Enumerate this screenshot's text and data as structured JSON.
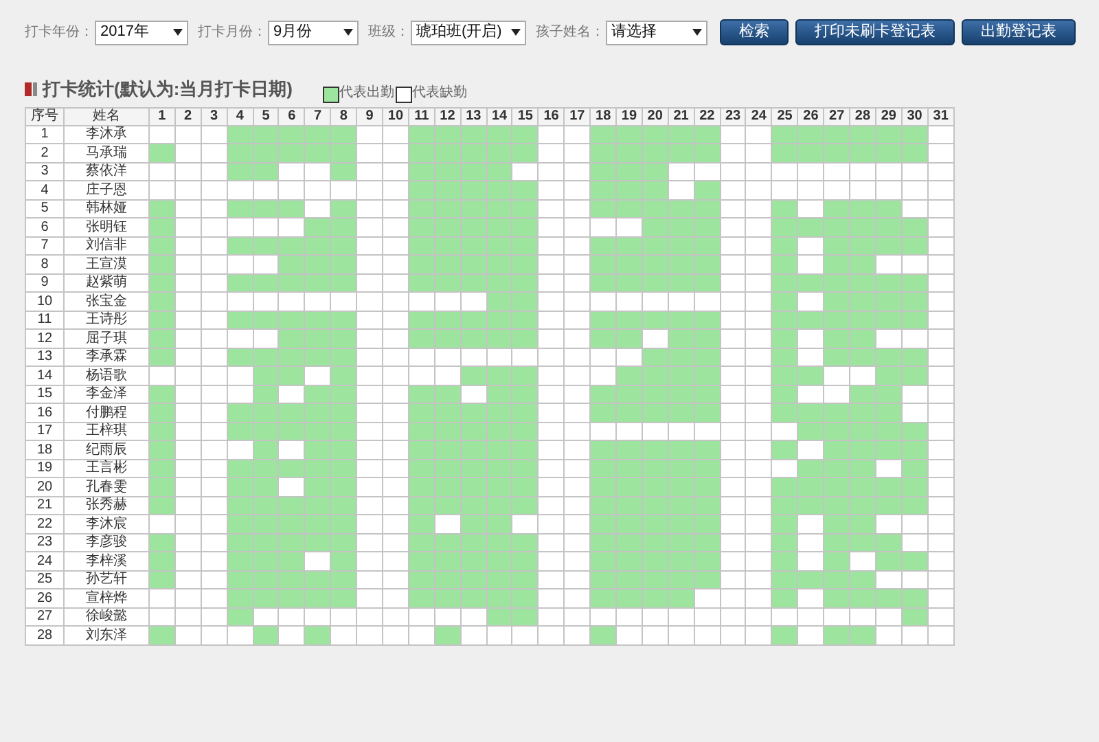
{
  "filters": [
    {
      "label": "打卡年份：",
      "value": "2017年"
    },
    {
      "label": "打卡月份：",
      "value": "9月份"
    },
    {
      "label": "班级：",
      "value": "琥珀班(开启)"
    },
    {
      "label": "孩子姓名：",
      "value": "请选择"
    }
  ],
  "buttons": [
    "检索",
    "打印未刷卡登记表",
    "出勤登记表"
  ],
  "section_title": "打卡统计(默认为:当月打卡日期)",
  "legend": [
    {
      "label": "代表出勤",
      "present": true
    },
    {
      "label": "代表缺勤",
      "present": false
    }
  ],
  "table": {
    "columns": [
      "序号",
      "姓名",
      "1",
      "2",
      "3",
      "4",
      "5",
      "6",
      "7",
      "8",
      "9",
      "10",
      "11",
      "12",
      "13",
      "14",
      "15",
      "16",
      "17",
      "18",
      "19",
      "20",
      "21",
      "22",
      "23",
      "24",
      "25",
      "26",
      "27",
      "28",
      "29",
      "30",
      "31"
    ],
    "rows": [
      {
        "no": "1",
        "name": "李沐承",
        "days": [
          false,
          false,
          false,
          true,
          true,
          true,
          true,
          true,
          false,
          false,
          true,
          true,
          true,
          true,
          true,
          false,
          false,
          true,
          true,
          true,
          true,
          true,
          false,
          false,
          true,
          true,
          true,
          true,
          true,
          true,
          false
        ]
      },
      {
        "no": "2",
        "name": "马承瑞",
        "days": [
          true,
          false,
          false,
          true,
          true,
          true,
          true,
          true,
          false,
          false,
          true,
          true,
          true,
          true,
          true,
          false,
          false,
          true,
          true,
          true,
          true,
          true,
          false,
          false,
          true,
          true,
          true,
          true,
          true,
          true,
          false
        ]
      },
      {
        "no": "3",
        "name": "蔡依洋",
        "days": [
          false,
          false,
          false,
          true,
          true,
          false,
          false,
          true,
          false,
          false,
          true,
          true,
          true,
          true,
          false,
          false,
          false,
          true,
          true,
          true,
          false,
          false,
          false,
          false,
          false,
          false,
          false,
          false,
          false,
          false,
          false
        ]
      },
      {
        "no": "4",
        "name": "庄子恩",
        "days": [
          false,
          false,
          false,
          false,
          false,
          false,
          false,
          false,
          false,
          false,
          true,
          true,
          true,
          true,
          true,
          false,
          false,
          true,
          true,
          true,
          false,
          true,
          false,
          false,
          false,
          false,
          false,
          false,
          false,
          false,
          false
        ]
      },
      {
        "no": "5",
        "name": "韩林娅",
        "days": [
          true,
          false,
          false,
          true,
          true,
          true,
          false,
          true,
          false,
          false,
          true,
          true,
          true,
          true,
          true,
          false,
          false,
          true,
          true,
          true,
          true,
          true,
          false,
          false,
          true,
          false,
          true,
          true,
          true,
          false,
          false
        ]
      },
      {
        "no": "6",
        "name": "张明钰",
        "days": [
          true,
          false,
          false,
          false,
          false,
          false,
          true,
          true,
          false,
          false,
          true,
          true,
          true,
          true,
          true,
          false,
          false,
          false,
          false,
          true,
          true,
          true,
          false,
          false,
          true,
          true,
          true,
          true,
          true,
          true,
          false
        ]
      },
      {
        "no": "7",
        "name": "刘信非",
        "days": [
          true,
          false,
          false,
          true,
          true,
          true,
          true,
          true,
          false,
          false,
          true,
          true,
          true,
          true,
          true,
          false,
          false,
          true,
          true,
          true,
          true,
          true,
          false,
          false,
          true,
          false,
          true,
          true,
          true,
          true,
          false
        ]
      },
      {
        "no": "8",
        "name": "王宣漠",
        "days": [
          true,
          false,
          false,
          false,
          false,
          true,
          true,
          true,
          false,
          false,
          true,
          true,
          true,
          true,
          true,
          false,
          false,
          true,
          true,
          true,
          true,
          true,
          false,
          false,
          true,
          false,
          true,
          true,
          false,
          false,
          false
        ]
      },
      {
        "no": "9",
        "name": "赵紫萌",
        "days": [
          true,
          false,
          false,
          true,
          true,
          true,
          true,
          true,
          false,
          false,
          true,
          true,
          true,
          true,
          true,
          false,
          false,
          true,
          true,
          true,
          true,
          true,
          false,
          false,
          true,
          true,
          true,
          true,
          true,
          true,
          false
        ]
      },
      {
        "no": "10",
        "name": "张宝金",
        "days": [
          true,
          false,
          false,
          false,
          false,
          false,
          false,
          false,
          false,
          false,
          false,
          false,
          false,
          true,
          true,
          false,
          false,
          false,
          false,
          false,
          false,
          false,
          false,
          false,
          true,
          false,
          true,
          true,
          true,
          true,
          false
        ]
      },
      {
        "no": "11",
        "name": "王诗彤",
        "days": [
          true,
          false,
          false,
          true,
          true,
          true,
          true,
          true,
          false,
          false,
          true,
          true,
          true,
          true,
          true,
          false,
          false,
          true,
          true,
          true,
          true,
          true,
          false,
          false,
          true,
          true,
          true,
          true,
          true,
          true,
          false
        ]
      },
      {
        "no": "12",
        "name": "屈子琪",
        "days": [
          true,
          false,
          false,
          false,
          false,
          true,
          true,
          true,
          false,
          false,
          true,
          true,
          true,
          true,
          true,
          false,
          false,
          true,
          true,
          false,
          true,
          true,
          false,
          false,
          true,
          false,
          true,
          true,
          false,
          false,
          false
        ]
      },
      {
        "no": "13",
        "name": "李承霖",
        "days": [
          true,
          false,
          false,
          true,
          true,
          true,
          true,
          true,
          false,
          false,
          false,
          false,
          false,
          false,
          false,
          false,
          false,
          false,
          false,
          true,
          true,
          true,
          false,
          false,
          true,
          false,
          true,
          true,
          true,
          true,
          false
        ]
      },
      {
        "no": "14",
        "name": "杨语歌",
        "days": [
          false,
          false,
          false,
          false,
          true,
          true,
          false,
          true,
          false,
          false,
          false,
          false,
          true,
          true,
          true,
          false,
          false,
          false,
          true,
          true,
          true,
          true,
          false,
          false,
          true,
          true,
          false,
          false,
          true,
          true,
          false
        ]
      },
      {
        "no": "15",
        "name": "李金泽",
        "days": [
          true,
          false,
          false,
          false,
          true,
          false,
          true,
          true,
          false,
          false,
          true,
          true,
          false,
          true,
          true,
          false,
          false,
          true,
          true,
          true,
          true,
          true,
          false,
          false,
          true,
          false,
          false,
          true,
          true,
          false,
          false
        ]
      },
      {
        "no": "16",
        "name": "付鹏程",
        "days": [
          true,
          false,
          false,
          true,
          true,
          true,
          true,
          true,
          false,
          false,
          true,
          true,
          true,
          true,
          true,
          false,
          false,
          true,
          true,
          true,
          true,
          true,
          false,
          false,
          true,
          true,
          true,
          true,
          true,
          false,
          false
        ]
      },
      {
        "no": "17",
        "name": "王梓琪",
        "days": [
          true,
          false,
          false,
          true,
          true,
          true,
          true,
          true,
          false,
          false,
          true,
          true,
          true,
          true,
          true,
          false,
          false,
          false,
          false,
          false,
          false,
          false,
          false,
          false,
          false,
          true,
          true,
          true,
          true,
          true,
          false
        ]
      },
      {
        "no": "18",
        "name": "纪雨辰",
        "days": [
          true,
          false,
          false,
          false,
          true,
          false,
          true,
          true,
          false,
          false,
          true,
          true,
          true,
          true,
          true,
          false,
          false,
          true,
          true,
          true,
          true,
          true,
          false,
          false,
          true,
          false,
          true,
          true,
          true,
          true,
          false
        ]
      },
      {
        "no": "19",
        "name": "王言彬",
        "days": [
          true,
          false,
          false,
          true,
          true,
          true,
          true,
          true,
          false,
          false,
          true,
          true,
          true,
          true,
          true,
          false,
          false,
          true,
          true,
          true,
          true,
          true,
          false,
          false,
          false,
          true,
          true,
          true,
          false,
          true,
          false
        ]
      },
      {
        "no": "20",
        "name": "孔春雯",
        "days": [
          true,
          false,
          false,
          true,
          true,
          false,
          true,
          true,
          false,
          false,
          true,
          true,
          true,
          true,
          true,
          false,
          false,
          true,
          true,
          true,
          true,
          true,
          false,
          false,
          true,
          true,
          true,
          true,
          true,
          true,
          false
        ]
      },
      {
        "no": "21",
        "name": "张秀赫",
        "days": [
          true,
          false,
          false,
          true,
          true,
          true,
          true,
          true,
          false,
          false,
          true,
          true,
          true,
          true,
          true,
          false,
          false,
          true,
          true,
          true,
          true,
          true,
          false,
          false,
          true,
          true,
          true,
          true,
          true,
          true,
          false
        ]
      },
      {
        "no": "22",
        "name": "李沐宸",
        "days": [
          false,
          false,
          false,
          true,
          true,
          true,
          true,
          true,
          false,
          false,
          true,
          false,
          true,
          true,
          false,
          false,
          false,
          true,
          true,
          true,
          true,
          true,
          false,
          false,
          true,
          false,
          true,
          true,
          false,
          false,
          false
        ]
      },
      {
        "no": "23",
        "name": "李彦骏",
        "days": [
          true,
          false,
          false,
          true,
          true,
          true,
          true,
          true,
          false,
          false,
          true,
          true,
          true,
          true,
          true,
          false,
          false,
          true,
          true,
          true,
          true,
          true,
          false,
          false,
          true,
          false,
          true,
          true,
          true,
          false,
          false
        ]
      },
      {
        "no": "24",
        "name": "李梓溪",
        "days": [
          true,
          false,
          false,
          true,
          true,
          true,
          false,
          true,
          false,
          false,
          true,
          true,
          true,
          true,
          true,
          false,
          false,
          true,
          true,
          true,
          true,
          true,
          false,
          false,
          true,
          false,
          true,
          false,
          true,
          true,
          false
        ]
      },
      {
        "no": "25",
        "name": "孙艺轩",
        "days": [
          true,
          false,
          false,
          true,
          true,
          true,
          true,
          true,
          false,
          false,
          true,
          true,
          true,
          true,
          true,
          false,
          false,
          true,
          true,
          true,
          true,
          true,
          false,
          false,
          true,
          true,
          true,
          true,
          false,
          false,
          false
        ]
      },
      {
        "no": "26",
        "name": "宣梓烨",
        "days": [
          false,
          false,
          false,
          true,
          true,
          true,
          true,
          true,
          false,
          false,
          true,
          true,
          true,
          true,
          true,
          false,
          false,
          true,
          true,
          true,
          true,
          false,
          false,
          false,
          true,
          false,
          true,
          true,
          true,
          true,
          false
        ]
      },
      {
        "no": "27",
        "name": "徐峻懿",
        "days": [
          false,
          false,
          false,
          true,
          false,
          false,
          false,
          false,
          false,
          false,
          false,
          false,
          false,
          true,
          true,
          false,
          false,
          false,
          false,
          false,
          false,
          false,
          false,
          false,
          false,
          false,
          false,
          false,
          false,
          true,
          false
        ]
      },
      {
        "no": "28",
        "name": "刘东泽",
        "days": [
          true,
          false,
          false,
          false,
          true,
          false,
          true,
          false,
          false,
          false,
          false,
          true,
          false,
          false,
          false,
          false,
          false,
          true,
          false,
          false,
          false,
          false,
          false,
          false,
          true,
          false,
          true,
          true,
          false,
          false,
          false
        ]
      }
    ]
  }
}
